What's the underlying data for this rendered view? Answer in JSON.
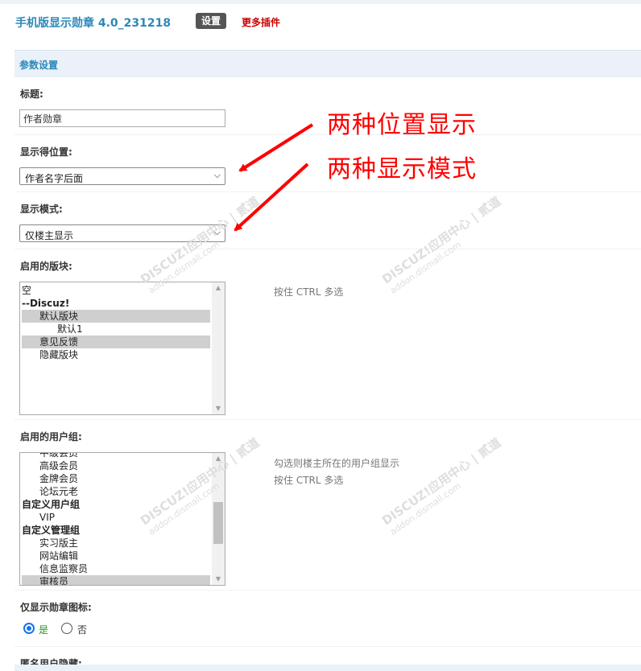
{
  "header": {
    "plugin_title": "手机版显示勋章 4.0_231218",
    "tab_settings": "设置",
    "more_plugins": "更多插件"
  },
  "section": {
    "title": "参数设置"
  },
  "fields": {
    "title_label": "标题:",
    "title_value": "作者勋章",
    "position_label": "显示得位置:",
    "position_value": "作者名字后面",
    "mode_label": "显示模式:",
    "mode_value": "仅楼主显示",
    "forums_label": "启用的版块:",
    "forums_hint": "按住 CTRL 多选",
    "groups_label": "启用的用户组:",
    "groups_hint_1": "勾选则楼主所在的用户组显示",
    "groups_hint_2": "按住 CTRL 多选",
    "icon_only_label": "仅显示勋章图标:",
    "radio_yes": "是",
    "radio_no": "否",
    "anon_label": "匿名用户隐藏:"
  },
  "forums_list": [
    {
      "label": "空",
      "indent": 0,
      "bold": false,
      "selected": false
    },
    {
      "label": "--Discuz!",
      "indent": 0,
      "bold": true,
      "selected": false
    },
    {
      "label": "默认版块",
      "indent": 1,
      "bold": false,
      "selected": true
    },
    {
      "label": "默认1",
      "indent": 2,
      "bold": false,
      "selected": false
    },
    {
      "label": "意见反馈",
      "indent": 1,
      "bold": false,
      "selected": true
    },
    {
      "label": "隐藏版块",
      "indent": 1,
      "bold": false,
      "selected": false
    }
  ],
  "groups_list": [
    {
      "label": "中级会员",
      "indent": 1,
      "bold": false,
      "selected": false
    },
    {
      "label": "高级会员",
      "indent": 1,
      "bold": false,
      "selected": false
    },
    {
      "label": "金牌会员",
      "indent": 1,
      "bold": false,
      "selected": false
    },
    {
      "label": "论坛元老",
      "indent": 1,
      "bold": false,
      "selected": false
    },
    {
      "label": "自定义用户组",
      "indent": 0,
      "bold": true,
      "selected": false
    },
    {
      "label": "VIP",
      "indent": 1,
      "bold": false,
      "selected": false
    },
    {
      "label": "自定义管理组",
      "indent": 0,
      "bold": true,
      "selected": false
    },
    {
      "label": "实习版主",
      "indent": 1,
      "bold": false,
      "selected": false
    },
    {
      "label": "网站编辑",
      "indent": 1,
      "bold": false,
      "selected": false
    },
    {
      "label": "信息监察员",
      "indent": 1,
      "bold": false,
      "selected": false
    },
    {
      "label": "审核员",
      "indent": 1,
      "bold": false,
      "selected": true
    }
  ],
  "groups_scroll_position": 0.55,
  "annotations": {
    "position_note": "两种位置显示",
    "mode_note": "两种显示模式"
  },
  "watermark": {
    "brand": "DISCUZ!应用中心 | 贰道",
    "site": "addon.dismall.com"
  },
  "colors": {
    "accent": "#2b89b8",
    "annotation": "#ff0000",
    "link_red": "#cc0000",
    "radio_yes": "#1a9c1a"
  }
}
